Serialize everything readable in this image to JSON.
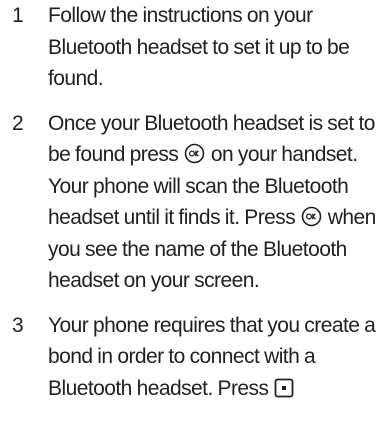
{
  "steps": [
    {
      "number": "1",
      "text": "Follow the instructions on your Bluetooth headset to set it up to be found."
    },
    {
      "number": "2",
      "text_a": "Once your Bluetooth headset is set to be found press",
      "text_b": "on your handset. Your phone will scan the Bluetooth headset until it finds it. Press",
      "text_c": "when you see the name of the Bluetooth headset on your screen.",
      "icon": "ok-button-icon"
    },
    {
      "number": "3",
      "text_a": "Your phone requires that you create a bond in order to connect with a Bluetooth headset. Press",
      "icon": "softkey-button-icon"
    }
  ]
}
